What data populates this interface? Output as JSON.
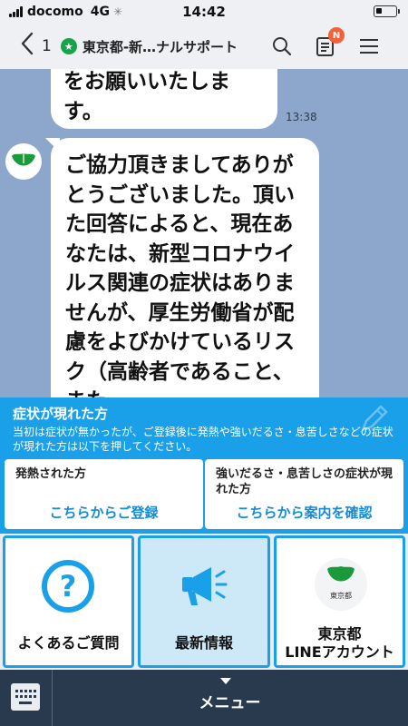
{
  "status_bar": {
    "carrier": "docomo",
    "network": "4G",
    "time": "14:42"
  },
  "header": {
    "back_count": "1",
    "title": "東京都-新…ナルサポート",
    "notification_badge": "N"
  },
  "messages": [
    {
      "text": "をお願いいたします。",
      "time": "13:38"
    },
    {
      "text": "ご協力頂きましてありがとうございました。頂いた回答によると、現在あなたは、新型コロナウイルス関連の症状はありませんが、厚生労働省が配慮をよびかけているリスク（高齢者であること、また"
    }
  ],
  "rich_menu": {
    "symptoms": {
      "title": "症状が現れた方",
      "description": "当初は症状が無かったが、ご登録後に発熱や強いだるさ・息苦しさなどの症状が現れた方は以下を押してください。",
      "left_button": {
        "caption": "発熱された方",
        "action": "こちらからご登録"
      },
      "right_button": {
        "caption": "強いだるさ・息苦しさの症状が現れた方",
        "action": "こちらから案内を確認"
      }
    },
    "tiles": [
      {
        "label": "よくあるご質問",
        "icon": "question-icon"
      },
      {
        "label": "最新情報",
        "icon": "megaphone-icon"
      },
      {
        "label_line1": "東京都",
        "label_line2": "LINEアカウント",
        "logo_text": "東京都",
        "icon": "tokyo-logo-icon"
      }
    ]
  },
  "bottom_bar": {
    "menu_label": "メニュー"
  },
  "colors": {
    "chat_background": "#8da6cb",
    "accent_blue": "#1aa0e8",
    "tokyo_green": "#1a9a3a",
    "badge_orange": "#f4603a"
  }
}
